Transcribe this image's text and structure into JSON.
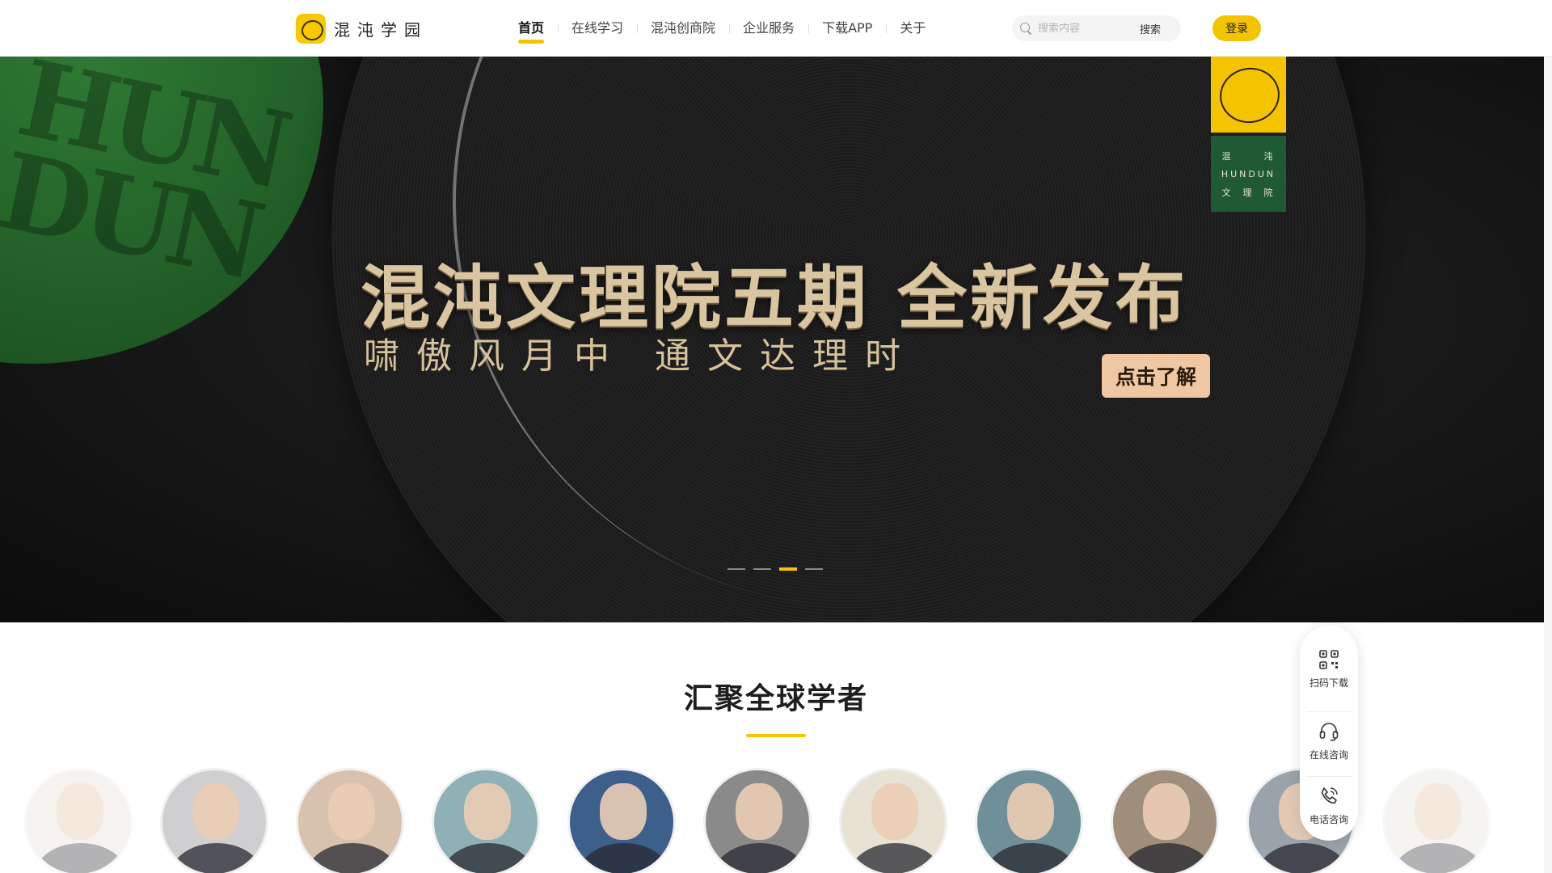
{
  "header": {
    "logo_text": "混沌学园",
    "nav": [
      {
        "label": "首页",
        "active": true
      },
      {
        "label": "在线学习",
        "active": false
      },
      {
        "label": "混沌创商院",
        "active": false
      },
      {
        "label": "企业服务",
        "active": false
      },
      {
        "label": "下载APP",
        "active": false
      },
      {
        "label": "关于",
        "active": false
      }
    ],
    "search_placeholder": "搜索内容",
    "search_button": "搜索",
    "login_button": "登录"
  },
  "banner": {
    "disc_text": "HUN DUN",
    "title": "混沌文理院五期 全新发布",
    "subtitle": "啸傲风月中 通文达理时",
    "cta": "点击了解",
    "badge": {
      "line1_left": "混",
      "line1_right": "沌",
      "line2": "HUNDUN",
      "line3": [
        "文",
        "理",
        "院"
      ]
    },
    "carousel": {
      "count": 4,
      "active_index": 2
    }
  },
  "section": {
    "title": "汇聚全球学者"
  },
  "scholars": [
    {
      "tone": "#e9e3dc",
      "faded": true
    },
    {
      "tone": "#cfcfd2"
    },
    {
      "tone": "#d8c2ae"
    },
    {
      "tone": "#8fb0b4"
    },
    {
      "tone": "#3d5f8c"
    },
    {
      "tone": "#8a8a8a"
    },
    {
      "tone": "#e7e2d4"
    },
    {
      "tone": "#6f8f99"
    },
    {
      "tone": "#a08e7d"
    },
    {
      "tone": "#9aa3ab"
    },
    {
      "tone": "#ece7e1",
      "faded": true
    }
  ],
  "float_panel": {
    "items": [
      {
        "label": "扫码下载",
        "icon": "qr-code-icon"
      },
      {
        "label": "在线咨询",
        "icon": "headset-icon"
      },
      {
        "label": "电话咨询",
        "icon": "phone-icon"
      }
    ]
  },
  "colors": {
    "accent": "#f5c400",
    "badge_green": "#1f5a35",
    "cta_bg": "#efc7a3"
  }
}
